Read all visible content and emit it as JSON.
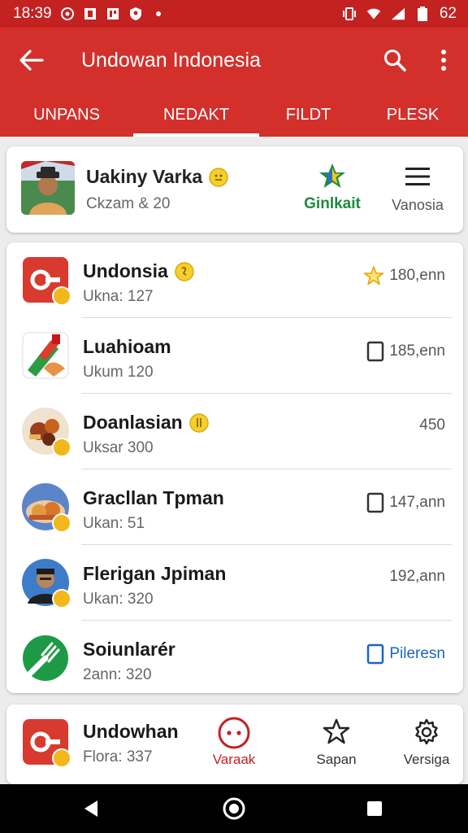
{
  "status_bar": {
    "time": "18:39",
    "battery": "62"
  },
  "app_bar": {
    "title": "Undowan Indonesia",
    "icons": [
      "back-arrow-icon",
      "search-icon",
      "more-vert-icon"
    ]
  },
  "tabs": [
    {
      "label": "UNPANS"
    },
    {
      "label": "NEDAKT",
      "active": true
    },
    {
      "label": "FILDT"
    },
    {
      "label": "PLESK"
    }
  ],
  "profile": {
    "name": "Uakiny Varka",
    "subtitle": "Ckzam & 20",
    "brand_text": "Ginlkait",
    "menu_label": "Vanosia"
  },
  "list": [
    {
      "title": "Undonsia",
      "subtitle": "Ukna: 127",
      "meta": "180,enn",
      "meta_icon": "star-icon",
      "title_emoji": true
    },
    {
      "title": "Luahioam",
      "subtitle": "Ukum 120",
      "meta": "185,enn",
      "meta_icon": "square-icon",
      "title_emoji": false
    },
    {
      "title": "Doanlasian",
      "subtitle": "Uksar 300",
      "meta": "450",
      "meta_icon": "",
      "title_emoji": true
    },
    {
      "title": "Gracllan Tpman",
      "subtitle": "Ukan: 51",
      "meta": "147,ann",
      "meta_icon": "square-icon",
      "title_emoji": false
    },
    {
      "title": "Flerigan Jpiman",
      "subtitle": "Ukan: 320",
      "meta": "192,ann",
      "meta_icon": "",
      "title_emoji": false
    },
    {
      "title": "Soiunlarér",
      "subtitle": "2ann: 320",
      "meta": "Pileresn",
      "meta_icon": "square-icon",
      "title_emoji": false
    }
  ],
  "bottom": {
    "title": "Undowhan",
    "subtitle": "Flora: 337",
    "nav": [
      {
        "label": "Varaak",
        "active": true
      },
      {
        "label": "Sapan"
      },
      {
        "label": "Versiga"
      }
    ]
  },
  "colors": {
    "primary": "#d3302c",
    "status": "#c42121",
    "accent_green": "#1e8a3e",
    "link_blue": "#1a66c0",
    "badge": "#f2b71b"
  }
}
